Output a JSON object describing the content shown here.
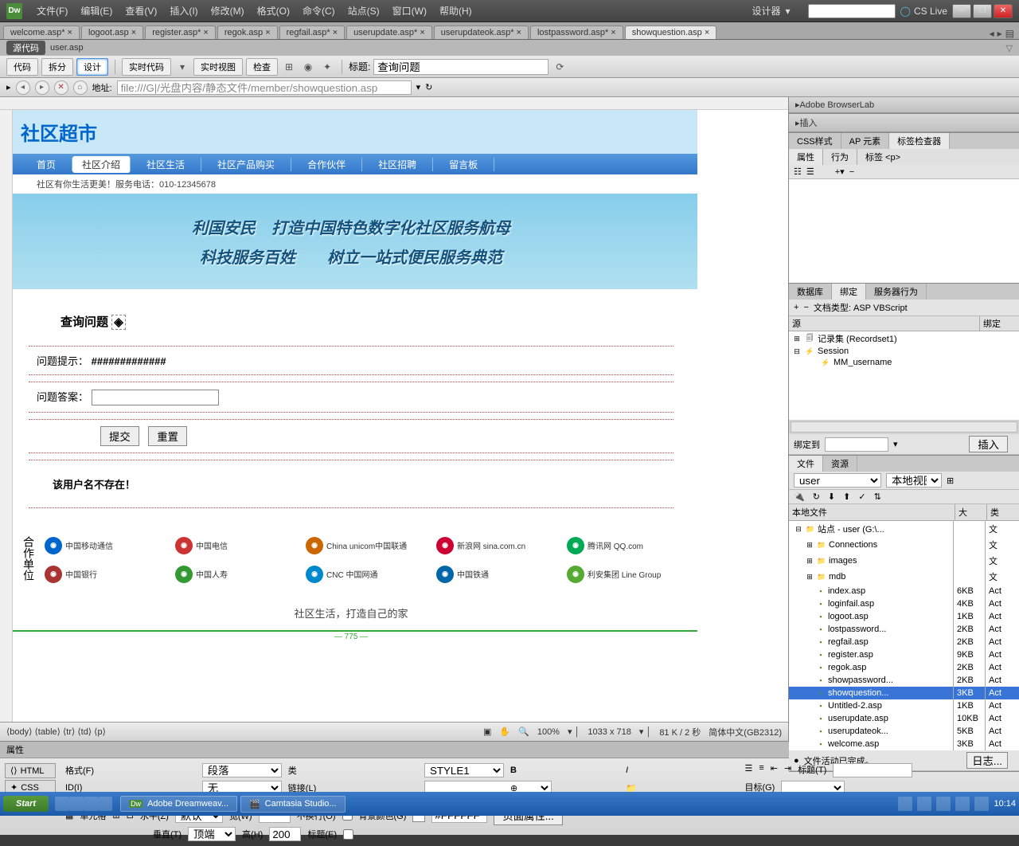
{
  "app": {
    "logo": "Dw",
    "designer_label": "设计器",
    "cslive": "CS Live"
  },
  "menu": [
    "文件(F)",
    "编辑(E)",
    "查看(V)",
    "插入(I)",
    "修改(M)",
    "格式(O)",
    "命令(C)",
    "站点(S)",
    "窗口(W)",
    "帮助(H)"
  ],
  "doc_tabs": [
    "welcome.asp*",
    "logoot.asp",
    "register.asp*",
    "regok.asp",
    "regfail.asp*",
    "userupdate.asp*",
    "userupdateok.asp*",
    "lostpassword.asp*",
    "showquestion.asp"
  ],
  "active_doc_idx": 8,
  "source_label": "源代码",
  "source_file": "user.asp",
  "toolbar": {
    "views": [
      "代码",
      "拆分",
      "设计"
    ],
    "active_view": 2,
    "live_code": "实时代码",
    "live_view": "实时视图",
    "inspect": "检查",
    "title_label": "标题:",
    "title_value": "查询问题"
  },
  "addr": {
    "label": "地址:",
    "value": "file:///G|/光盘内容/静态文件/member/showquestion.asp"
  },
  "site": {
    "title": "社区超市",
    "nav": [
      "首页",
      "社区介绍",
      "社区生活",
      "社区产品购买",
      "合作伙伴",
      "社区招聘",
      "留言板"
    ],
    "active_nav": 1,
    "sub_banner": "社区有你生活更美！服务电话：010-12345678",
    "hero1": "利国安民　打造中国特色数字化社区服务航母",
    "hero2": "科技服务百姓　　树立一站式便民服务典范",
    "query_title": "查询问题",
    "hint_label": "问题提示：",
    "hint_value": "#############",
    "answer_label": "问题答案：",
    "submit": "提交",
    "reset": "重置",
    "error": "该用户名不存在！",
    "partner_label": "合作单位",
    "partners": [
      "中国移动通信",
      "中国电信",
      "China unicom中国联通",
      "新浪网 sina.com.cn",
      "腾讯网 QQ.com",
      "中国银行",
      "中国人寿",
      "CNC 中国网通",
      "中国铁通",
      "利安集团 Line Group"
    ],
    "footer": "社区生活，打造自己的家",
    "measure": "775"
  },
  "status": {
    "path": "⟨body⟩ ⟨table⟩ ⟨tr⟩ ⟨td⟩ ⟨p⟩",
    "zoom": "100%",
    "dims": "1033 x 718",
    "size": "81 K / 2 秒",
    "encoding": "简体中文(GB2312)"
  },
  "props": {
    "header": "属性",
    "html_mode": "HTML",
    "css_mode": "CSS",
    "format_label": "格式(F)",
    "format_value": "段落",
    "class_label": "类",
    "class_value": "STYLE1",
    "id_label": "ID(I)",
    "id_value": "无",
    "link_label": "链接(L)",
    "title_label": "标题(T)",
    "target_label": "目标(G)",
    "cell_label": "单元格",
    "horiz_label": "水平(Z)",
    "horiz_value": "默认",
    "vert_label": "垂直(T)",
    "vert_value": "顶端",
    "width_label": "宽(W)",
    "height_label": "高(H)",
    "height_value": "200",
    "nowrap_label": "不换行(O)",
    "header_label": "标题(E)",
    "bgcolor_label": "背景颜色(G)",
    "bgcolor_value": "#FFFFFF",
    "page_props": "页面属性..."
  },
  "right": {
    "browserlab": "Adobe BrowserLab",
    "insert": "插入",
    "css": "CSS样式",
    "ap": "AP 元素",
    "tag_inspector": "标签检查器",
    "attrs": "属性",
    "behavior": "行为",
    "tag": "标签 <p>",
    "db": "数据库",
    "bind": "绑定",
    "server_behavior": "服务器行为",
    "doc_type": "文档类型: ASP VBScript",
    "recordset": "记录集 (Recordset1)",
    "session": "Session",
    "mm_user": "MM_username",
    "bind_to": "绑定到",
    "insert_btn": "插入",
    "files": "文件",
    "resources": "资源",
    "site_name": "user",
    "view": "本地视图",
    "cols": {
      "name": "本地文件",
      "size": "大",
      "type": "类"
    },
    "site_root": "站点 - user (G:\\...",
    "folders": [
      "Connections",
      "images",
      "mdb"
    ],
    "file_list": [
      {
        "n": "index.asp",
        "s": "6KB",
        "t": "Act"
      },
      {
        "n": "loginfail.asp",
        "s": "4KB",
        "t": "Act"
      },
      {
        "n": "logoot.asp",
        "s": "1KB",
        "t": "Act"
      },
      {
        "n": "lostpassword...",
        "s": "2KB",
        "t": "Act"
      },
      {
        "n": "regfail.asp",
        "s": "2KB",
        "t": "Act"
      },
      {
        "n": "register.asp",
        "s": "9KB",
        "t": "Act"
      },
      {
        "n": "regok.asp",
        "s": "2KB",
        "t": "Act"
      },
      {
        "n": "showpassword...",
        "s": "2KB",
        "t": "Act"
      },
      {
        "n": "showquestion...",
        "s": "3KB",
        "t": "Act"
      },
      {
        "n": "Untitled-2.asp",
        "s": "1KB",
        "t": "Act"
      },
      {
        "n": "userupdate.asp",
        "s": "10KB",
        "t": "Act"
      },
      {
        "n": "userupdateok...",
        "s": "5KB",
        "t": "Act"
      },
      {
        "n": "welcome.asp",
        "s": "3KB",
        "t": "Act"
      }
    ],
    "selected_file": 8,
    "activity": "文件活动已完成。",
    "log": "日志..."
  },
  "taskbar": {
    "start": "Start",
    "apps": [
      "Adobe Dreamweav...",
      "Camtasia Studio..."
    ],
    "time": "10:14"
  }
}
